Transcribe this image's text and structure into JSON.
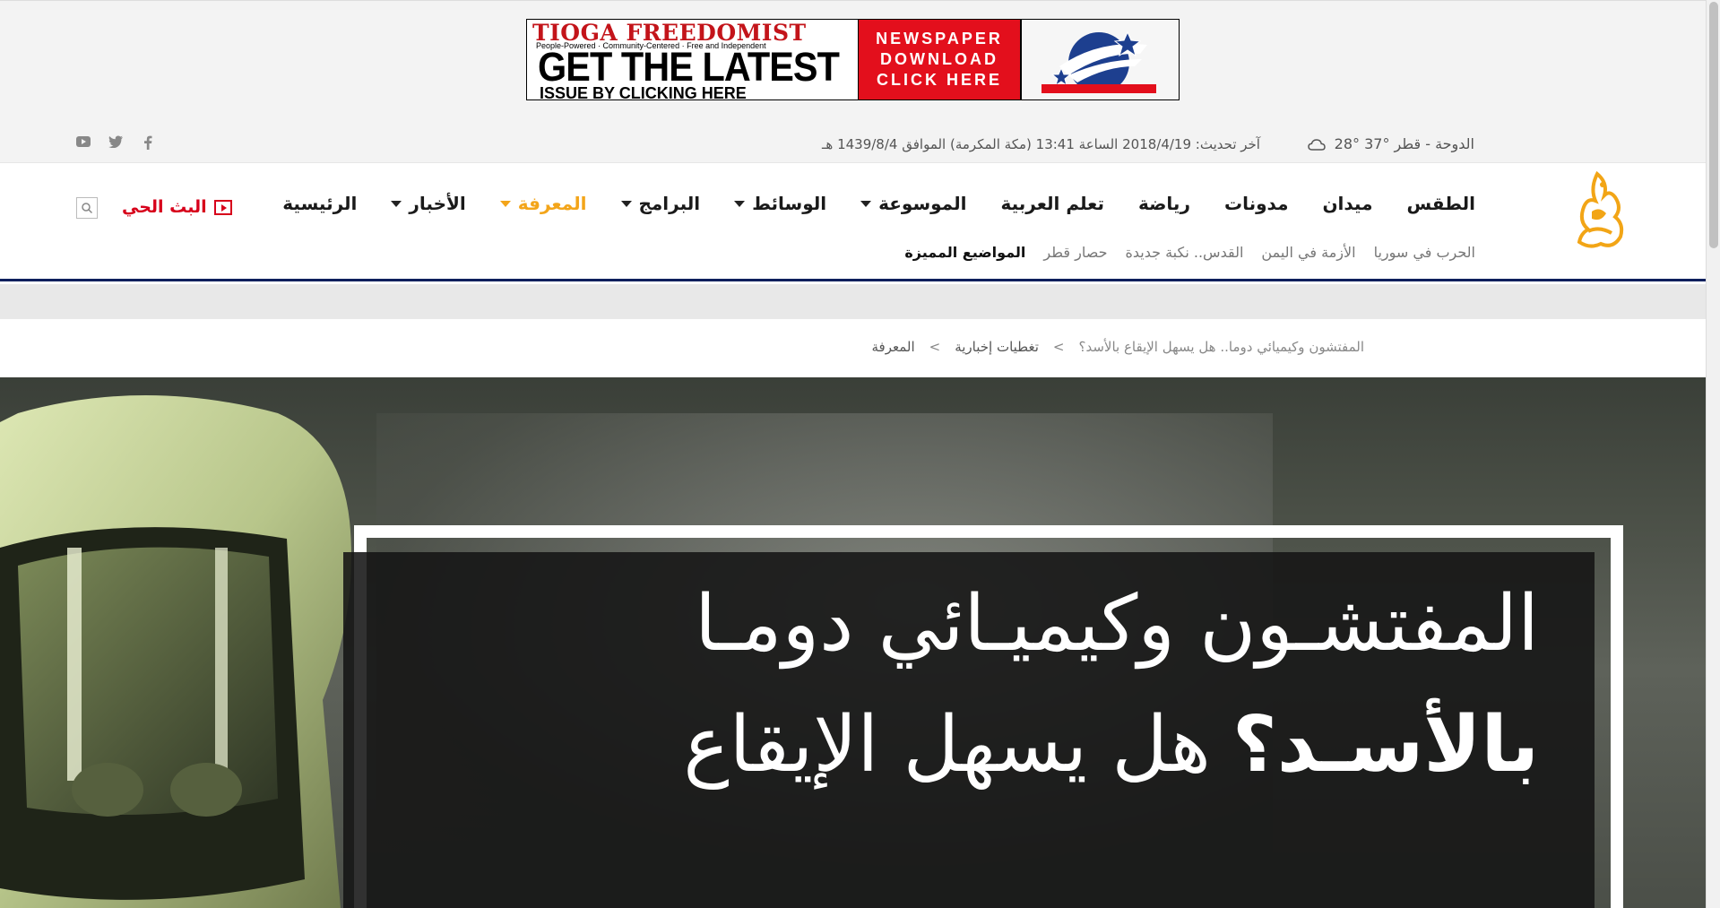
{
  "ad": {
    "brand": "TIOGA FREEDOMIST",
    "tagline": "People-Powered · Community-Centered · Free and Independent",
    "headline": "GET THE LATEST",
    "subline": "ISSUE BY CLICKING HERE",
    "cta_lines": [
      "NEWSPAPER",
      "DOWNLOAD",
      "CLICK HERE"
    ]
  },
  "info_bar": {
    "weather": "الدوحة - قطر °37 °28",
    "updated": "آخر تحديث: 2018/4/19 الساعة 13:41 (مكة المكرمة) الموافق 1439/8/4 هـ",
    "social": [
      "facebook-icon",
      "twitter-icon",
      "youtube-icon"
    ]
  },
  "nav": {
    "items": [
      {
        "label": "الرئيسية",
        "dropdown": false,
        "active": false
      },
      {
        "label": "الأخبار",
        "dropdown": true,
        "active": false
      },
      {
        "label": "المعرفة",
        "dropdown": true,
        "active": true
      },
      {
        "label": "البرامج",
        "dropdown": true,
        "active": false
      },
      {
        "label": "الوسائط",
        "dropdown": true,
        "active": false
      },
      {
        "label": "الموسوعة",
        "dropdown": true,
        "active": false
      },
      {
        "label": "تعلم العربية",
        "dropdown": false,
        "active": false
      },
      {
        "label": "رياضة",
        "dropdown": false,
        "active": false
      },
      {
        "label": "مدونات",
        "dropdown": false,
        "active": false
      },
      {
        "label": "ميدان",
        "dropdown": false,
        "active": false
      },
      {
        "label": "الطقس",
        "dropdown": false,
        "active": false
      }
    ],
    "live_label": "البث الحي",
    "active_color": "#f3a51a",
    "live_color": "#d7001b"
  },
  "featured": {
    "title": "المواضيع المميزة",
    "items": [
      "حصار قطر",
      "القدس.. نكبة جديدة",
      "الأزمة في اليمن",
      "الحرب في سوريا"
    ]
  },
  "breadcrumb": {
    "items": [
      "المعرفة",
      "تغطيات إخبارية",
      "المفتشون وكيميائي دوما.. هل يسهل الإيقاع بالأسد؟"
    ],
    "separator": ">"
  },
  "hero": {
    "line1": "المفتشـون وكيميـائي دومـا",
    "line2_prefix": "هل يسهل الإيقاع",
    "line2_bold": "بالأسـد؟"
  }
}
